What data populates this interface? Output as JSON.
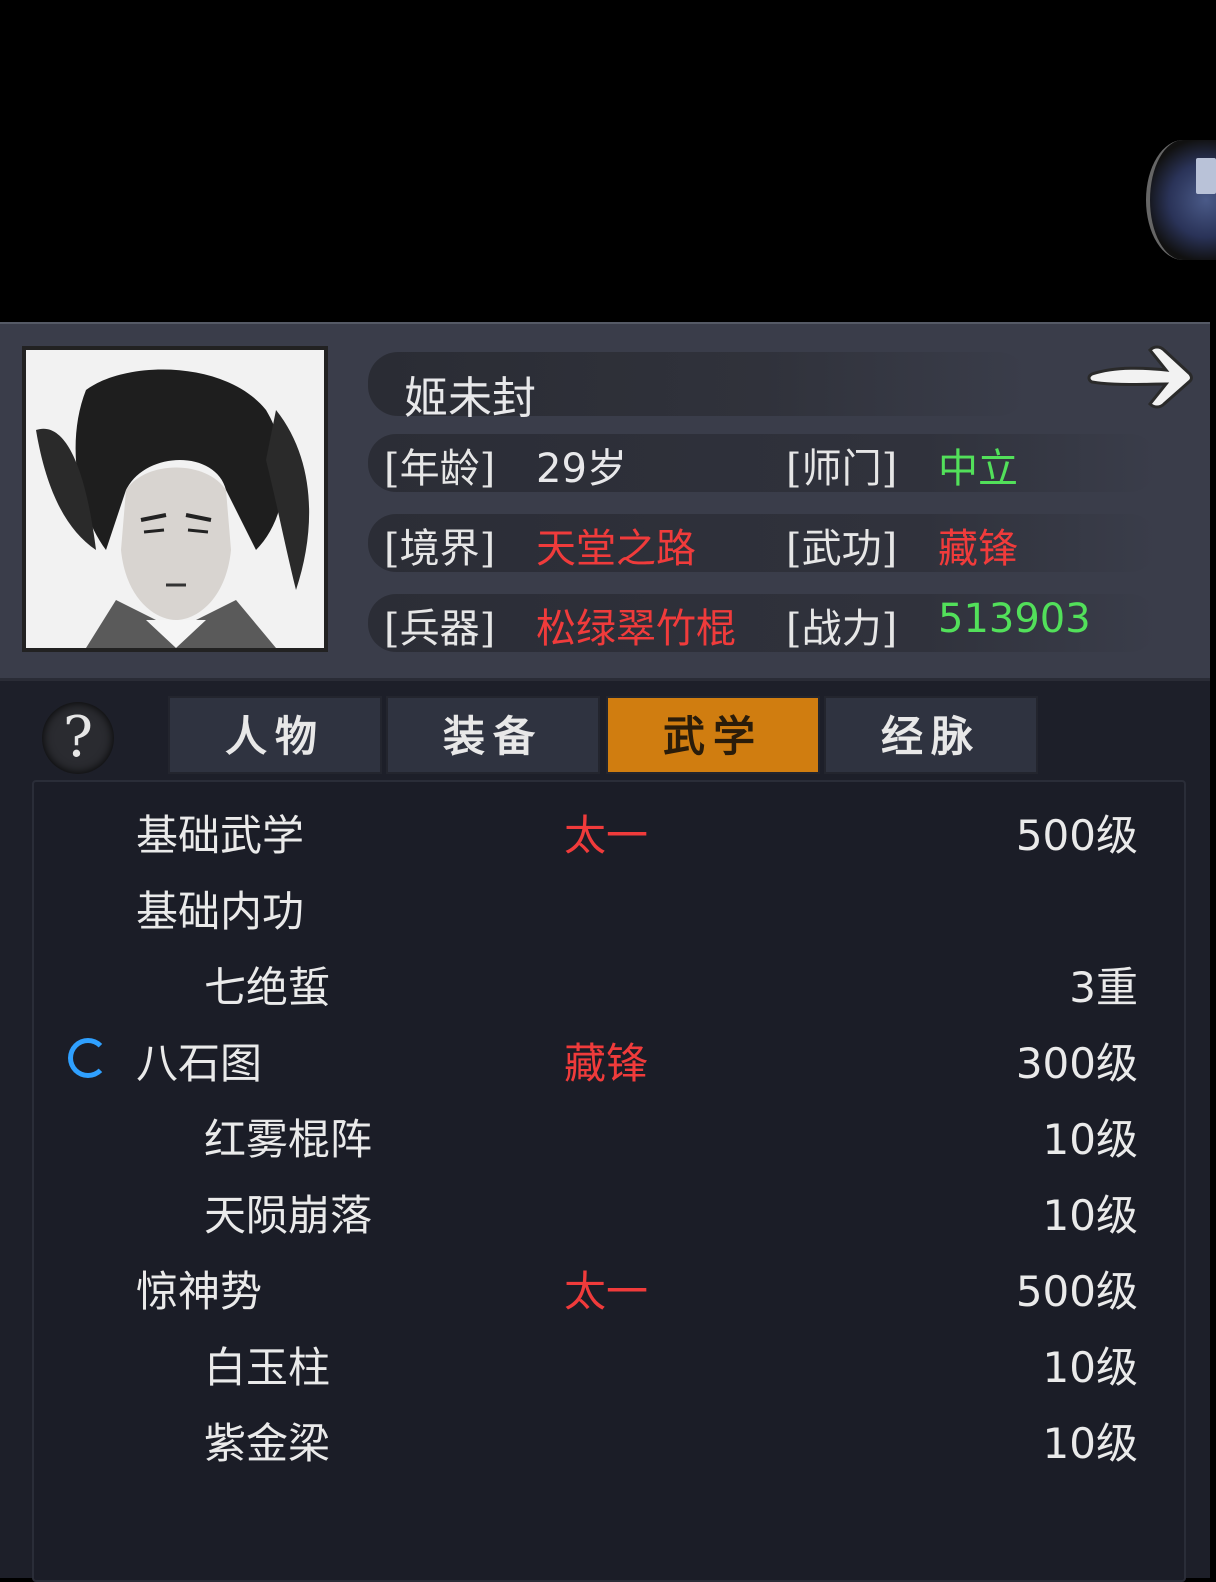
{
  "character": {
    "name": "姬未封",
    "stats": {
      "age_label": "[年龄]",
      "age_value": "29岁",
      "sect_label": "[师门]",
      "sect_value": "中立",
      "realm_label": "[境界]",
      "realm_value": "天堂之路",
      "martial_label": "[武功]",
      "martial_value": "藏锋",
      "weapon_label": "[兵器]",
      "weapon_value": "松绿翠竹棍",
      "power_label": "[战力]",
      "power_value": "513903"
    }
  },
  "tabs": {
    "help": "?",
    "items": [
      {
        "label": "人物"
      },
      {
        "label": "装备"
      },
      {
        "label": "武学"
      },
      {
        "label": "经脉"
      }
    ],
    "active": "武学"
  },
  "skills": [
    {
      "name": "基础武学",
      "school": "太一",
      "level": "500级",
      "indent": false,
      "loading": false
    },
    {
      "name": "基础内功",
      "school": "",
      "level": "",
      "indent": false,
      "loading": false
    },
    {
      "name": "七绝蜇",
      "school": "",
      "level": "3重",
      "indent": true,
      "loading": false
    },
    {
      "name": "八石图",
      "school": "藏锋",
      "level": "300级",
      "indent": false,
      "loading": true
    },
    {
      "name": "红雾棍阵",
      "school": "",
      "level": "10级",
      "indent": true,
      "loading": false
    },
    {
      "name": "天陨崩落",
      "school": "",
      "level": "10级",
      "indent": true,
      "loading": false
    },
    {
      "name": "惊神势",
      "school": "太一",
      "level": "500级",
      "indent": false,
      "loading": false
    },
    {
      "name": "白玉柱",
      "school": "",
      "level": "10级",
      "indent": true,
      "loading": false
    },
    {
      "name": "紫金梁",
      "school": "",
      "level": "10级",
      "indent": true,
      "loading": false
    }
  ],
  "colors": {
    "accent_tab": "#d07d10",
    "red": "#f03b3b",
    "green": "#52e05a",
    "loading": "#2fa0ff"
  },
  "icons": {
    "next": "arrow-right-icon",
    "help": "question-mark-icon",
    "loading": "loading-spinner-icon",
    "corner": "book-scroll-icon"
  }
}
